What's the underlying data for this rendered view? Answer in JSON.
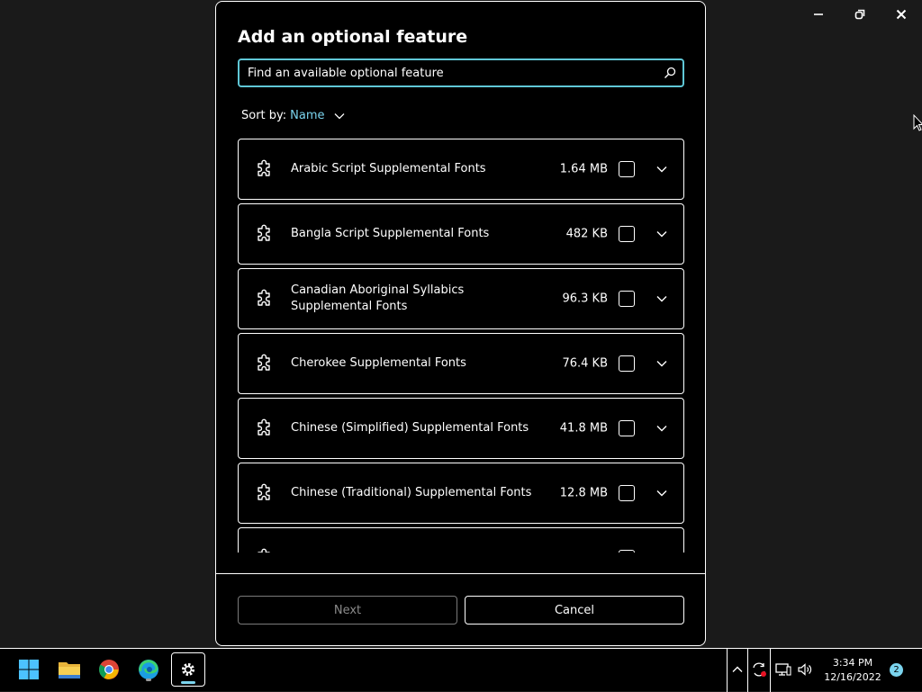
{
  "window_controls": {
    "minimize_icon": "minimize-icon",
    "restore_icon": "restore-icon",
    "close_icon": "close-icon"
  },
  "dialog": {
    "title": "Add an optional feature",
    "search": {
      "placeholder": "Find an available optional feature",
      "value": ""
    },
    "sort": {
      "label": "Sort by:",
      "value": "Name"
    },
    "features": [
      {
        "name": "Arabic Script Supplemental Fonts",
        "size": "1.64 MB",
        "checked": false
      },
      {
        "name": "Bangla Script Supplemental Fonts",
        "size": "482 KB",
        "checked": false
      },
      {
        "name": "Canadian Aboriginal Syllabics Supplemental Fonts",
        "size": "96.3 KB",
        "checked": false
      },
      {
        "name": "Cherokee Supplemental Fonts",
        "size": "76.4 KB",
        "checked": false
      },
      {
        "name": "Chinese (Simplified) Supplemental Fonts",
        "size": "41.8 MB",
        "checked": false
      },
      {
        "name": "Chinese (Traditional) Supplemental Fonts",
        "size": "12.8 MB",
        "checked": false
      },
      {
        "name": "",
        "size": "",
        "checked": false
      }
    ],
    "buttons": {
      "next": "Next",
      "cancel": "Cancel"
    }
  },
  "taskbar": {
    "apps": [
      "start-icon",
      "file-explorer-icon",
      "chrome-icon",
      "edge-icon",
      "settings-icon"
    ],
    "clock": {
      "time": "3:34 PM",
      "date": "12/16/2022"
    },
    "notification_count": "2"
  },
  "colors": {
    "accent": "#7bd4ee",
    "search_border": "#5fc7d6",
    "background": "#000000"
  }
}
